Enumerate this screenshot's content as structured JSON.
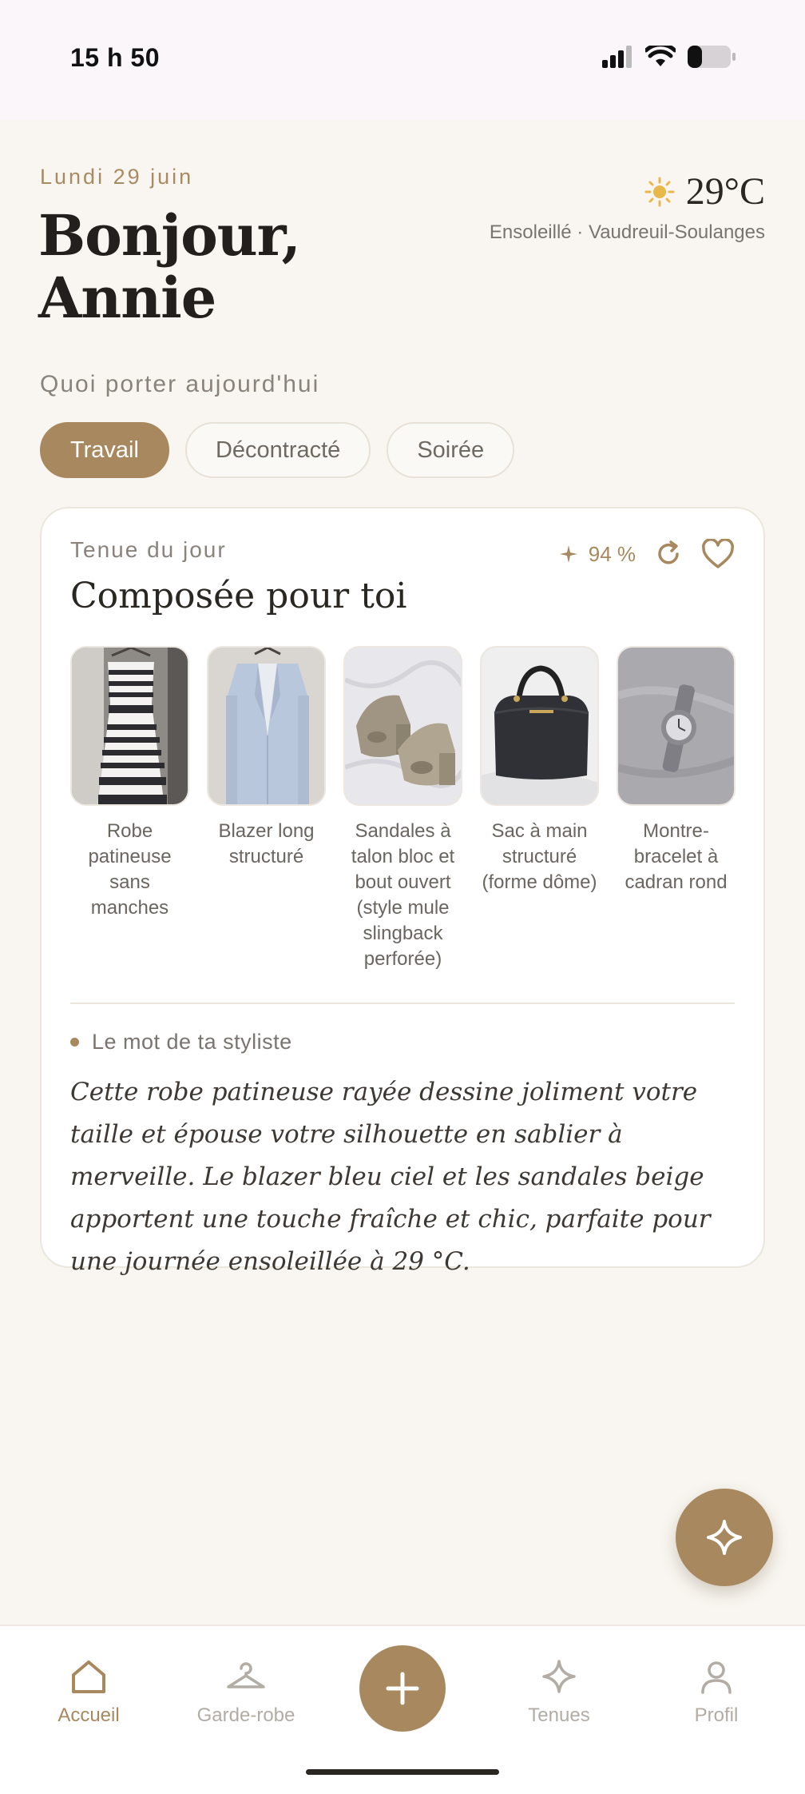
{
  "status": {
    "time": "15 h 50"
  },
  "header": {
    "date": "Lundi 29 juin",
    "greeting": "Bonjour, Annie",
    "weather": {
      "temp": "29°C",
      "desc": "Ensoleillé · Vaudreuil-Soulanges",
      "icon": "sun-icon"
    }
  },
  "section_label": "Quoi porter aujourd'hui",
  "chips": [
    {
      "label": "Travail",
      "active": true
    },
    {
      "label": "Décontracté",
      "active": false
    },
    {
      "label": "Soirée",
      "active": false
    }
  ],
  "card": {
    "eyebrow": "Tenue du jour",
    "title": "Composée pour toi",
    "score": "94 %",
    "items": [
      {
        "label": "Robe patineuse sans manches"
      },
      {
        "label": "Blazer long structuré"
      },
      {
        "label": "Sandales à talon bloc et bout ouvert (style mule slingback perforée)"
      },
      {
        "label": "Sac à main structuré (forme dôme)"
      },
      {
        "label": "Montre-bracelet à cadran rond"
      }
    ],
    "stylist_heading": "Le mot de ta styliste",
    "stylist_text": "Cette robe patineuse rayée dessine joliment votre taille et épouse votre silhouette en sablier à merveille. Le blazer bleu ciel et les sandales beige apportent une touche fraîche et chic, parfaite pour une journée ensoleillée à 29 °C."
  },
  "tabbar": {
    "home": "Accueil",
    "wardrobe": "Garde-robe",
    "outfits": "Tenues",
    "profile": "Profil"
  },
  "colors": {
    "accent": "#a8885f",
    "background": "#f9f6f1"
  }
}
